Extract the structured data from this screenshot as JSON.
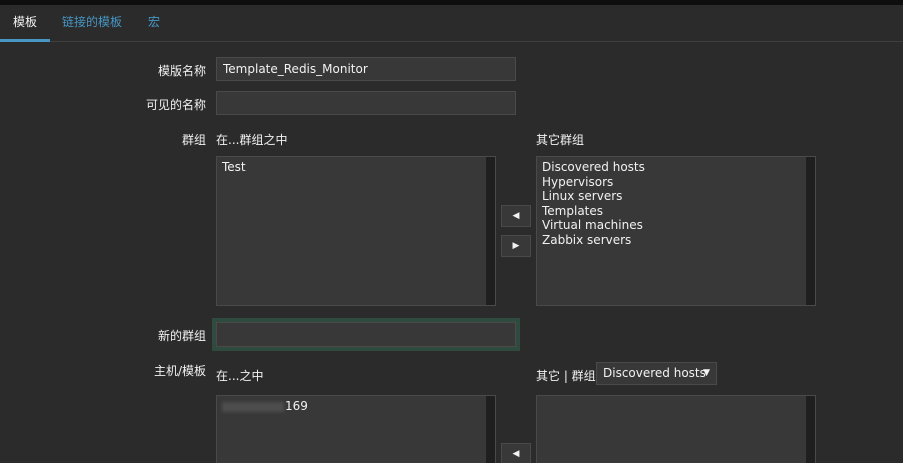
{
  "tabs": [
    {
      "label": "模板",
      "active": true
    },
    {
      "label": "链接的模板",
      "active": false
    },
    {
      "label": "宏",
      "active": false
    }
  ],
  "form": {
    "template_name_label": "模版名称",
    "template_name_value": "Template_Redis_Monitor",
    "visible_name_label": "可见的名称",
    "visible_name_value": "",
    "groups_label": "群组",
    "in_groups_label": "在...群组之中",
    "other_groups_label": "其它群组",
    "in_groups": [
      "Test"
    ],
    "other_groups": [
      "Discovered hosts",
      "Hypervisors",
      "Linux servers",
      "Templates",
      "Virtual machines",
      "Zabbix servers"
    ],
    "new_group_label": "新的群组",
    "new_group_value": "",
    "hosts_label": "主机/模板",
    "in_hosts_label": "在...之中",
    "other_hosts_label": "其它 | 群组",
    "other_hosts_group_select": "Discovered hosts",
    "in_hosts_visible_suffix": "169",
    "other_hosts": []
  },
  "icons": {
    "move_left": "◀",
    "move_right": "▶",
    "dropdown": "▼"
  },
  "colors": {
    "background": "#2b2b2b",
    "link": "#4796c4",
    "input_bg": "#383838",
    "focus_border": "#2f4a3f"
  }
}
